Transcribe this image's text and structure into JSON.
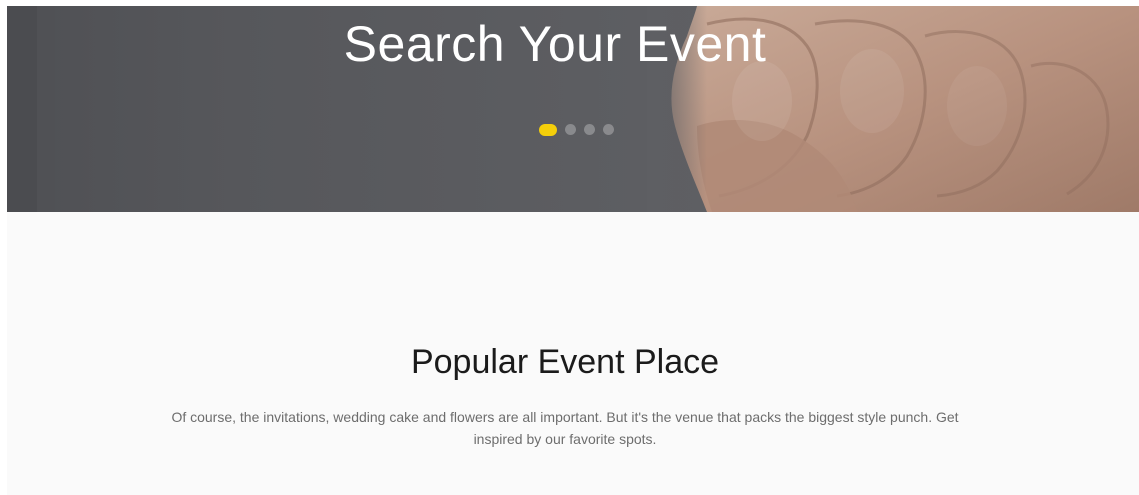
{
  "hero": {
    "title": "Search Your Event",
    "carousel": {
      "slide_count": 4,
      "active_index": 0,
      "active_color": "#f5cf0a"
    },
    "background_color": "#5b5c60",
    "image": "hand-fist-photo"
  },
  "section": {
    "title": "Popular Event Place",
    "description": "Of course, the invitations, wedding cake and flowers are all important. But it's the venue that packs the biggest style punch. Get inspired by our favorite spots.",
    "background_color": "#fafafa"
  }
}
